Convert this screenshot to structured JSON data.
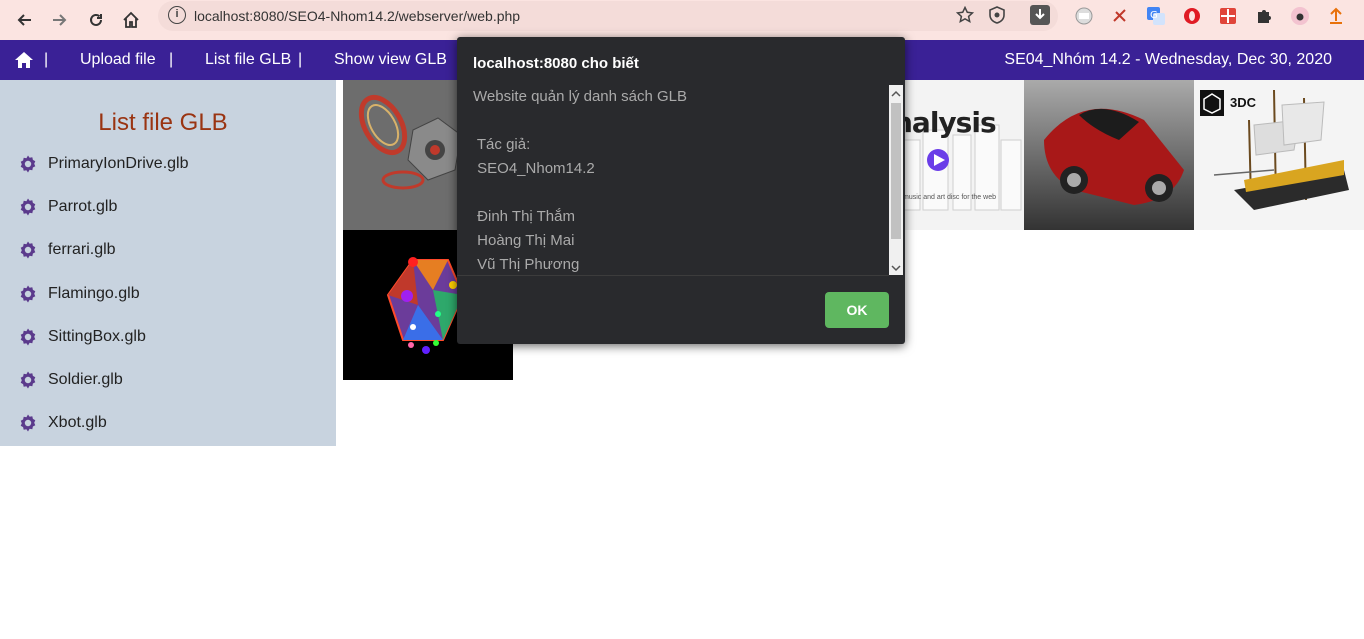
{
  "browser": {
    "url": "localhost:8080/SEO4-Nhom14.2/webserver/web.php",
    "info_icon": "i"
  },
  "navbar": {
    "home_icon": "home-icon",
    "items": [
      "Upload file",
      "List file GLB",
      "Show view GLB"
    ],
    "separator": "|",
    "right_text": "SE04_Nhóm 14.2 - Wednesday, Dec 30, 2020",
    "bg_color": "#3a2196"
  },
  "sidebar": {
    "title": "List file GLB",
    "files": [
      "PrimaryIonDrive.glb",
      "Parrot.glb",
      "ferrari.glb",
      "Flamingo.glb",
      "SittingBox.glb",
      "Soldier.glb",
      "Xbot.glb"
    ]
  },
  "thumbnails": {
    "analysis_text": "nalysis",
    "analysis_caption": "music and art disc for the web",
    "threedc_text": "3DC"
  },
  "dialog": {
    "title": "localhost:8080 cho biết",
    "lines": [
      "Website quản lý danh sách GLB",
      "",
      " Tác giả:",
      " SEO4_Nhom14.2",
      "",
      " Đinh Thị Thắm",
      " Hoàng Thị Mai",
      " Vũ Thị Phương"
    ],
    "ok_label": "OK"
  }
}
